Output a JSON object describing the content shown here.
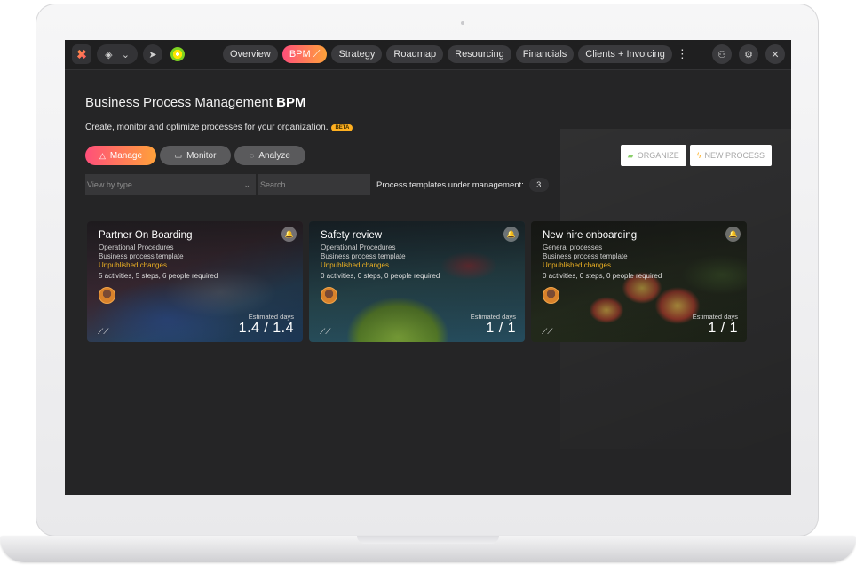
{
  "topbar": {
    "layers_chevron": "⌄",
    "nav_tabs": [
      {
        "label": "Overview"
      },
      {
        "label": "BPM"
      },
      {
        "label": "Strategy"
      },
      {
        "label": "Roadmap"
      },
      {
        "label": "Resourcing"
      },
      {
        "label": "Financials"
      },
      {
        "label": "Clients + Invoicing"
      }
    ],
    "active_tab": "BPM",
    "icons": [
      "app-logo-icon",
      "layers-icon",
      "chevron-down-icon",
      "send-icon",
      "bp-logo-icon",
      "more-vertical-icon",
      "users-icon",
      "gear-icon",
      "close-icon"
    ]
  },
  "header": {
    "title_main": "Business Process Management",
    "title_bold": "BPM",
    "subtitle": "Create, monitor and optimize processes for your organization.",
    "beta_badge": "BETA"
  },
  "mode_tabs": [
    {
      "label": "Manage",
      "icon": "warning-triangle-icon",
      "active": true
    },
    {
      "label": "Monitor",
      "icon": "monitor-icon",
      "active": false
    },
    {
      "label": "Analyze",
      "icon": "analyze-icon",
      "active": false
    }
  ],
  "actions": {
    "organize_label": "ORGANIZE",
    "new_process_label": "NEW PROCESS"
  },
  "filters": {
    "type_placeholder": "View by type...",
    "search_placeholder": "Search...",
    "templates_label": "Process templates under management:",
    "templates_count": "3"
  },
  "cards": [
    {
      "title": "Partner On Boarding",
      "category": "Operational Procedures",
      "kind": "Business process template",
      "status": "Unpublished changes",
      "summary": "5 activities, 5 steps, 6 people required",
      "estimated_label": "Estimated days",
      "estimated_value": "1.4 / 1.4"
    },
    {
      "title": "Safety review",
      "category": "Operational Procedures",
      "kind": "Business process template",
      "status": "Unpublished changes",
      "summary": "0 activities, 0 steps, 0 people required",
      "estimated_label": "Estimated days",
      "estimated_value": "1 / 1"
    },
    {
      "title": "New hire onboarding",
      "category": "General processes",
      "kind": "Business process template",
      "status": "Unpublished changes",
      "summary": "0 activities, 0 steps, 0 people required",
      "estimated_label": "Estimated days",
      "estimated_value": "1 / 1"
    }
  ],
  "colors": {
    "accent_start": "#ff4f7a",
    "accent_end": "#ffa23a",
    "status_unpublished": "#f0b323",
    "background": "#252526"
  }
}
